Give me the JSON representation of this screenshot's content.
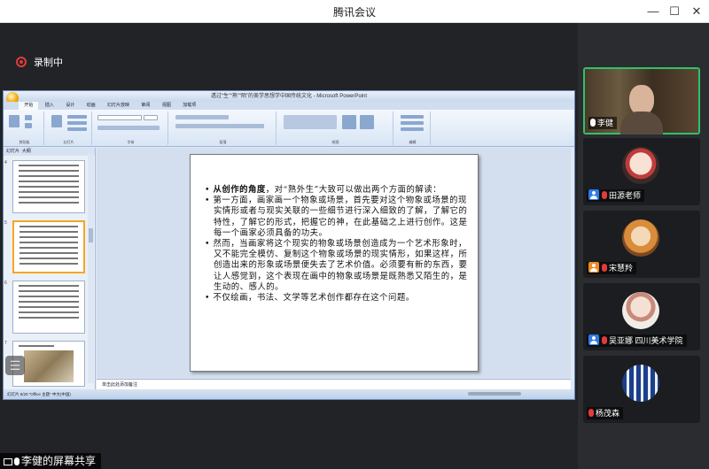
{
  "app": {
    "window_title": "腾讯会议",
    "window_controls": {
      "minimize": "—",
      "maximize": "☐",
      "close": "✕"
    },
    "recording_label": "录制中",
    "share_label": "李健的屏幕共享"
  },
  "ppt": {
    "title": "透过“生”“熟”“陌”的美学思想学中国传统文化 - Microsoft PowerPoint",
    "tabs": [
      "开始",
      "插入",
      "设计",
      "动画",
      "幻灯片放映",
      "审阅",
      "视图",
      "加载项"
    ],
    "groups": [
      "剪贴板",
      "幻灯片",
      "字体",
      "段落",
      "绘图",
      "编辑"
    ],
    "panel_tabs": [
      "幻灯片",
      "大纲"
    ],
    "thumb_numbers": [
      "4",
      "5",
      "6",
      "7"
    ],
    "notes_placeholder": "单击此处添加备注",
    "status_text": "幻灯片 5/20 “Office 主题” 中文(中国)"
  },
  "slide": {
    "p1_bold": "从创作的角度",
    "p1_rest": "，对“熟外生”大致可以做出两个方面的解读：",
    "p2": "第一方面，画家画一个物象或场景，首先要对这个物象或场景的现实情形或者与现实关联的一些细节进行深入细致的了解，了解它的特性，了解它的形式，把握它的神，在此基础之上进行创作。这是每一个画家必须具备的功夫。",
    "p3": "然而，当画家将这个现实的物象或场景创造成为一个艺术形象时，又不能完全模仿、复制这个物象或场景的现实情形，如果这样，所创造出来的形象或场景便失去了艺术价值。必须要有新的东西，要让人感觉到，这个表现在画中的物象或场景是既熟悉又陌生的，是生动的、感人的。",
    "p4": "不仅绘画，书法、文学等艺术创作都存在这个问题。",
    "bullet": "•"
  },
  "participants": [
    {
      "name": "李健",
      "role": "speaker",
      "mic": "on"
    },
    {
      "name": "田源老师",
      "mic": "muted",
      "icon": "user-icon-blue"
    },
    {
      "name": "宋慧羚",
      "mic": "muted",
      "icon": "user-icon-orange"
    },
    {
      "name": "吴亚娜 四川美术学院",
      "mic": "muted",
      "icon": "user-icon-blue"
    },
    {
      "name": "杨茂森",
      "mic": "muted"
    }
  ],
  "colors": {
    "active_border": "#2fc26a",
    "muted_mic": "#e23b3b",
    "recording": "#e23b3b"
  }
}
